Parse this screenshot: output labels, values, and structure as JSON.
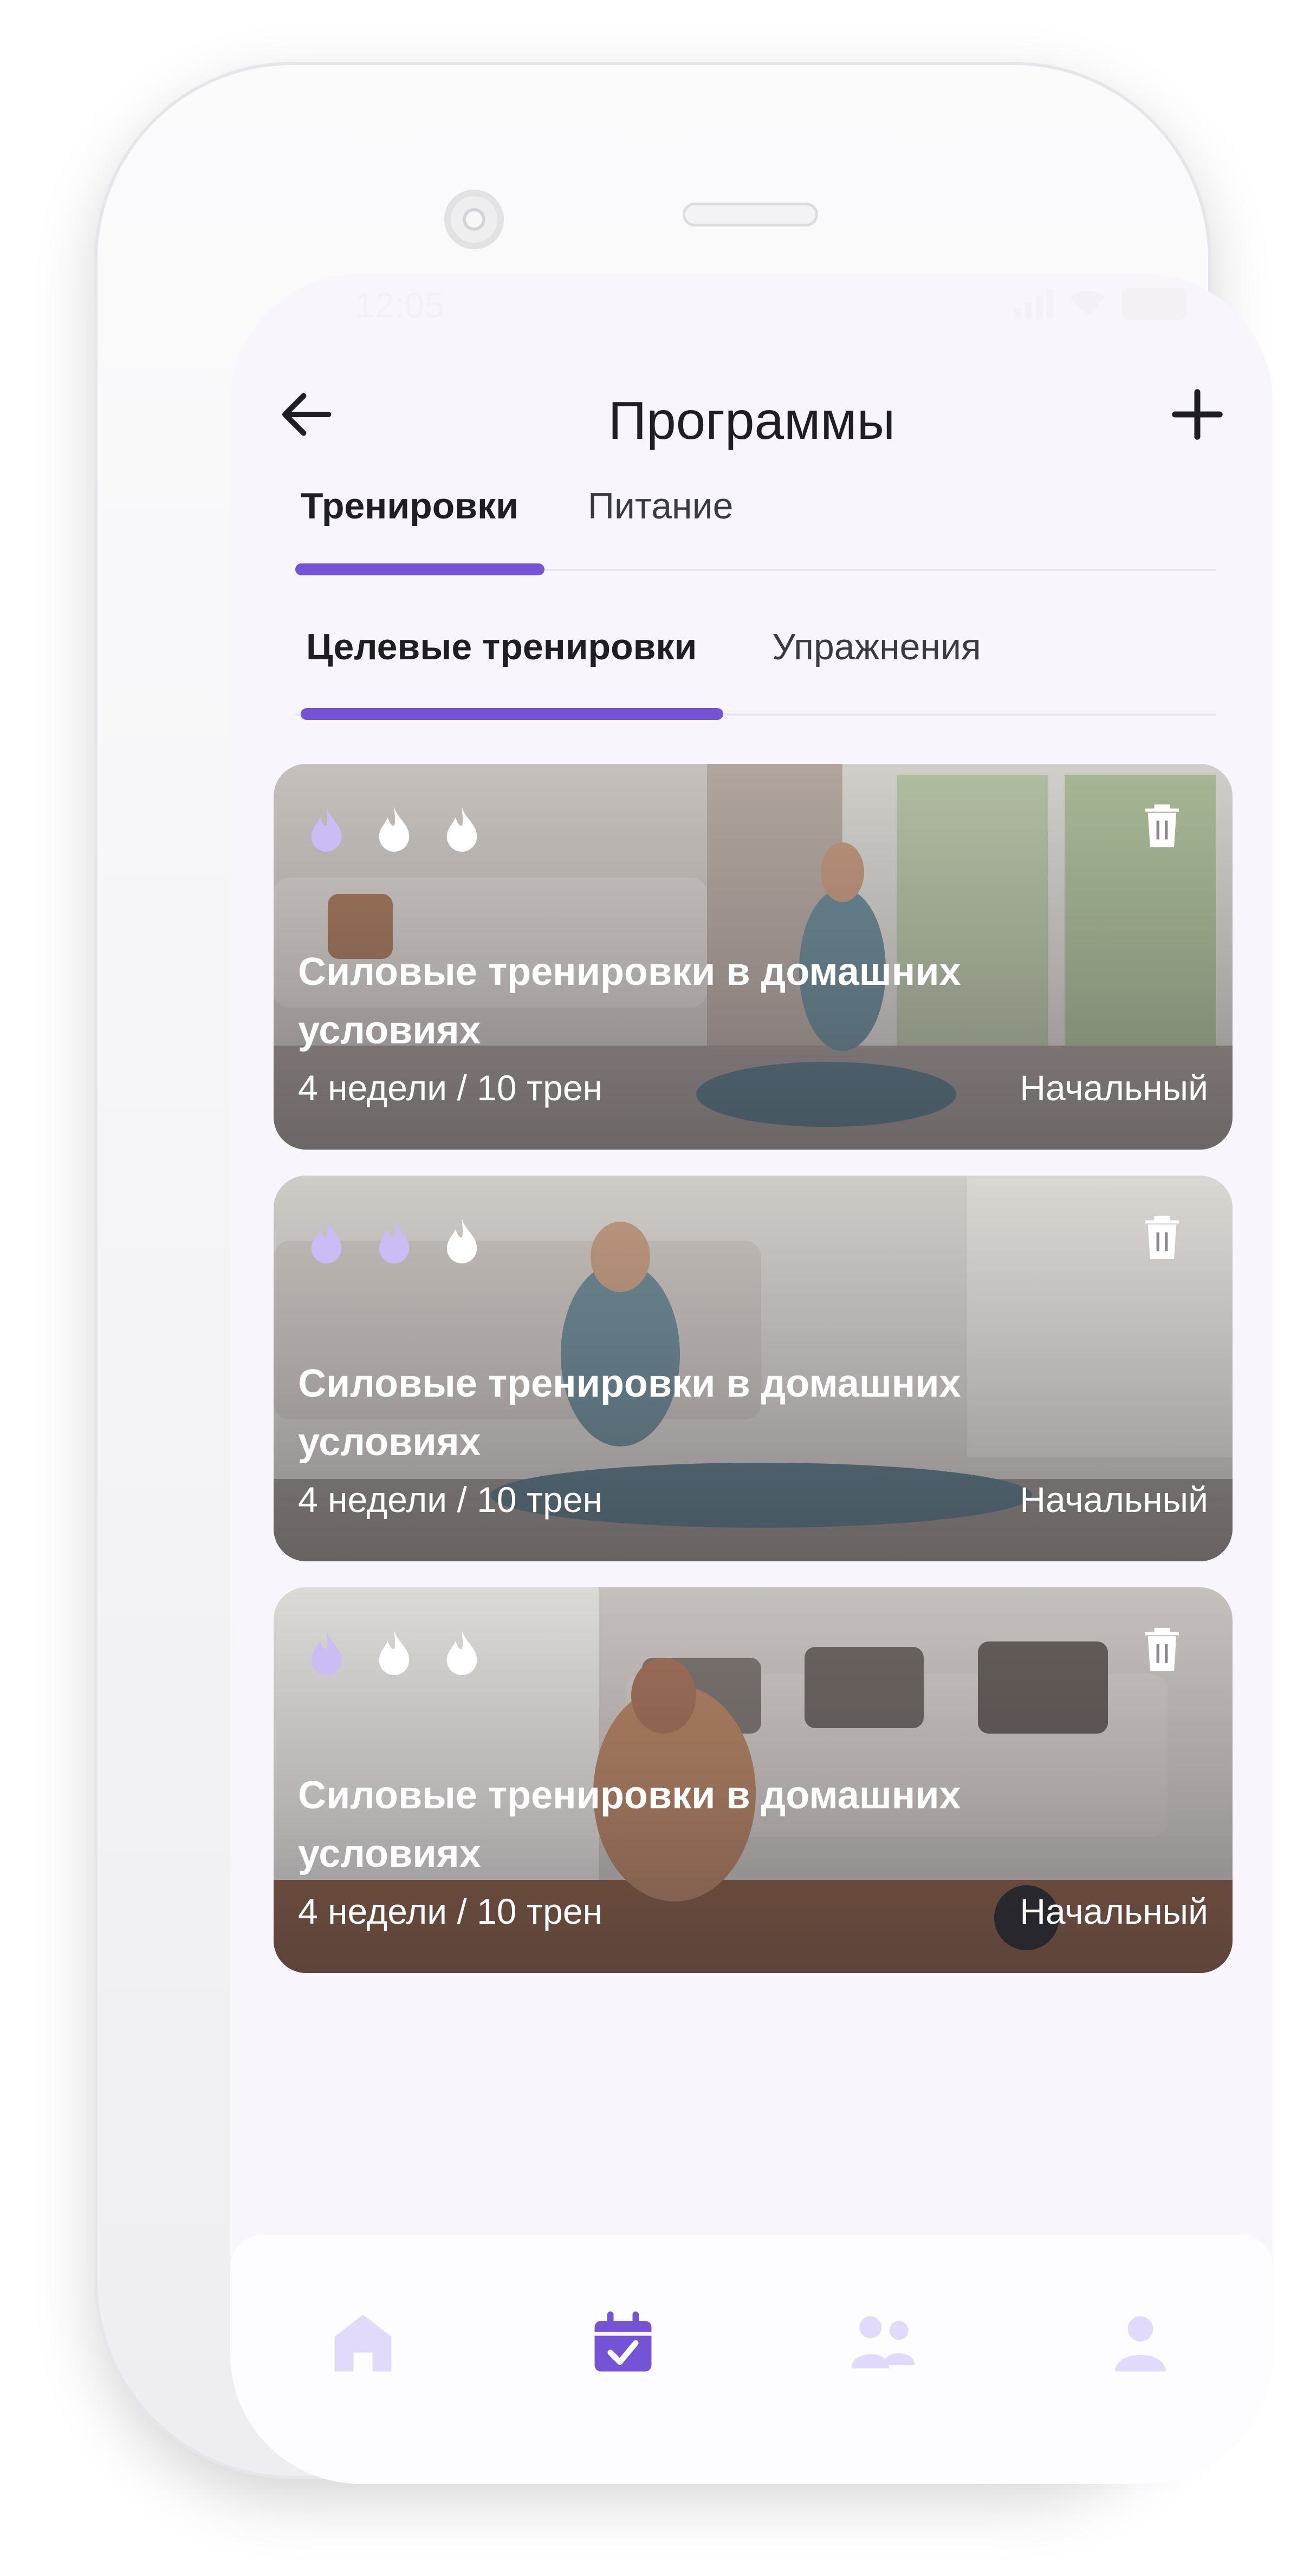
{
  "status_bar": {
    "time": "12:05",
    "battery": "100"
  },
  "header": {
    "title": "Программы"
  },
  "main_tabs": {
    "active": "Тренировки",
    "other": "Питание"
  },
  "sub_tabs": {
    "active": "Целевые тренировки",
    "other": "Упражнения"
  },
  "programs": [
    {
      "title": "Силовые тренировки в домашних условиях",
      "duration": "4 недели",
      "separator": "/",
      "workouts": "10 трен",
      "level": "Начальный",
      "intensity": 1,
      "image": "woman-stretching-living-room"
    },
    {
      "title": "Силовые тренировки в домашних условиях",
      "duration": "4 недели",
      "separator": "/",
      "workouts": "10 трен",
      "level": "Начальный",
      "intensity": 2,
      "image": "woman-seated-forward-stretch"
    },
    {
      "title": "Силовые тренировки в домашних условиях",
      "duration": "4 недели",
      "separator": "/",
      "workouts": "10 трен",
      "level": "Начальный",
      "intensity": 1,
      "image": "man-seated-stretch-living-room"
    }
  ],
  "bottom_nav": [
    {
      "icon": "home-icon",
      "active": false
    },
    {
      "icon": "calendar-check-icon",
      "active": true
    },
    {
      "icon": "users-icon",
      "active": false
    },
    {
      "icon": "user-icon",
      "active": false
    }
  ],
  "colors": {
    "accent": "#7553d6",
    "accent_light": "#cbbcf5",
    "nav_inactive": "#e2dafb"
  }
}
